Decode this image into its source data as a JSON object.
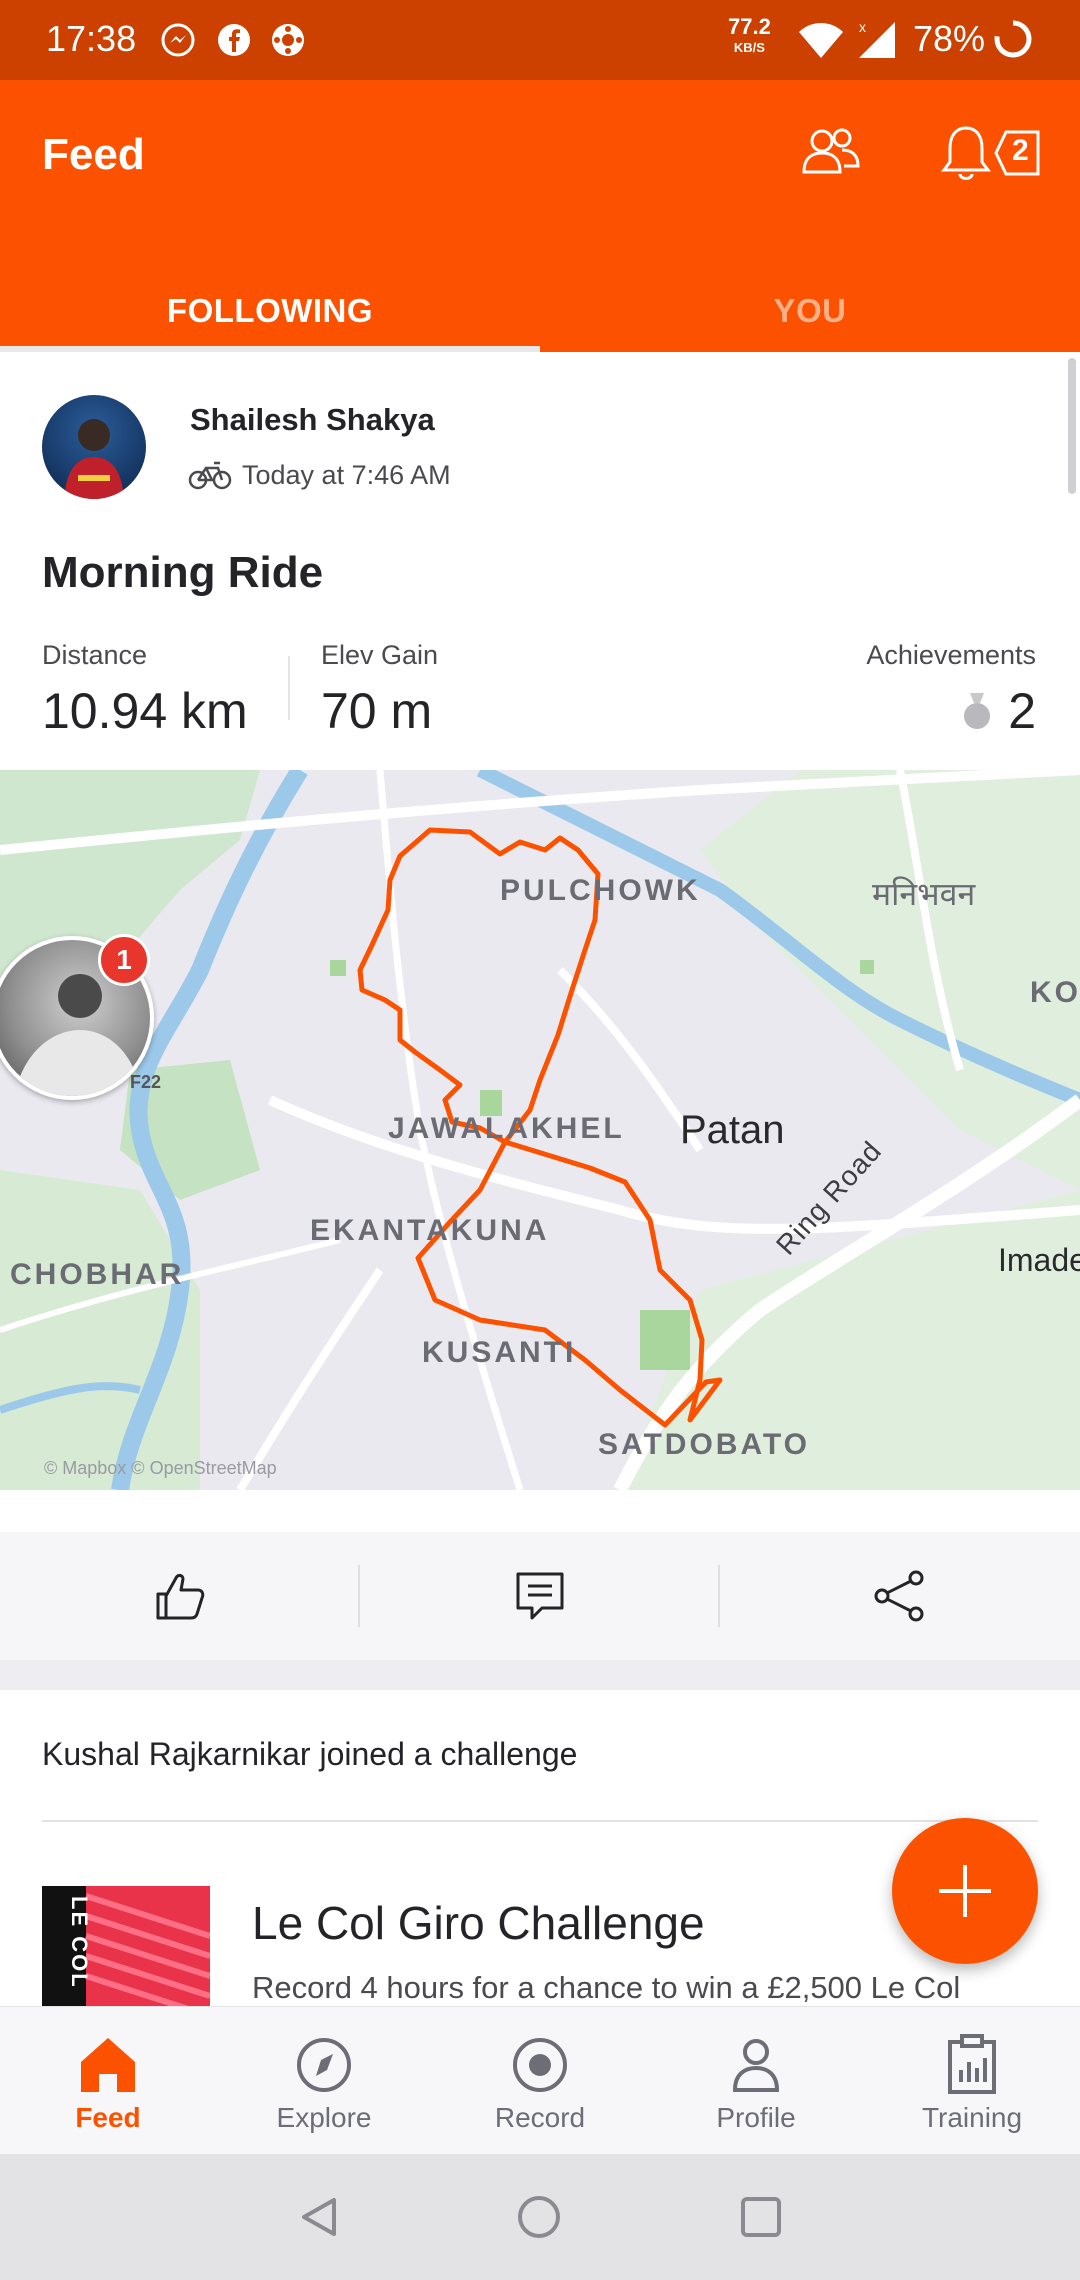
{
  "status_bar": {
    "time": "17:38",
    "speed": "77.2",
    "speed_unit": "KB/S",
    "battery": "78%"
  },
  "header": {
    "title": "Feed",
    "notification_count": "2",
    "tabs": [
      {
        "label": "FOLLOWING",
        "active": true
      },
      {
        "label": "YOU",
        "active": false
      }
    ]
  },
  "activity": {
    "athlete_name": "Shailesh Shakya",
    "timestamp": "Today at 7:46 AM",
    "title": "Morning Ride",
    "stats": {
      "distance_label": "Distance",
      "distance_value": "10.94 km",
      "elev_label": "Elev Gain",
      "elev_value": "70 m",
      "achievements_label": "Achievements",
      "achievements_value": "2"
    },
    "map": {
      "labels": {
        "pulchowk": "PULCHOWK",
        "jawalakhel": "JAWALAKHEL",
        "patan": "Patan",
        "ekantakuna": "EKANTAKUNA",
        "chobhar": "CHOBHAR",
        "kusanti": "KUSANTI",
        "satdobato": "SATDOBATO",
        "ring_road": "Ring Road",
        "imad": "Imade",
        "mani": "मनिभवन",
        "ko": "KO",
        "f22": "F22",
        "attribution": "© Mapbox © OpenStreetMap"
      },
      "avatar_badge": "1",
      "route_color": "#fc5200"
    }
  },
  "challenge": {
    "text": "Kushal Rajkarnikar joined a challenge",
    "logo_text": "LE COL",
    "title": "Le Col Giro Challenge",
    "description": "Record 4 hours for a chance to win a £2,500 Le Col"
  },
  "bottom_nav": [
    {
      "label": "Feed",
      "icon": "home-icon",
      "active": true
    },
    {
      "label": "Explore",
      "icon": "compass-icon"
    },
    {
      "label": "Record",
      "icon": "record-icon"
    },
    {
      "label": "Profile",
      "icon": "profile-icon"
    },
    {
      "label": "Training",
      "icon": "training-icon"
    }
  ],
  "colors": {
    "brand": "#fc5200",
    "status_bar": "#cc4000"
  }
}
